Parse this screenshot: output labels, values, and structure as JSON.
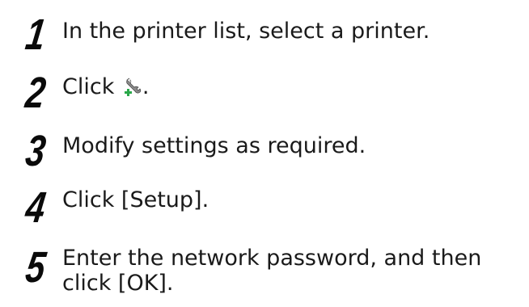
{
  "steps": [
    {
      "number": "1",
      "text": "In the printer list, select a printer."
    },
    {
      "number": "2",
      "text_before": "Click ",
      "text_after": ".",
      "icon": "wrench-plus-icon"
    },
    {
      "number": "3",
      "text": "Modify settings as required."
    },
    {
      "number": "4",
      "text": "Click [Setup]."
    },
    {
      "number": "5",
      "line1": "Enter the network password, and then",
      "line2": "click [OK]."
    }
  ]
}
